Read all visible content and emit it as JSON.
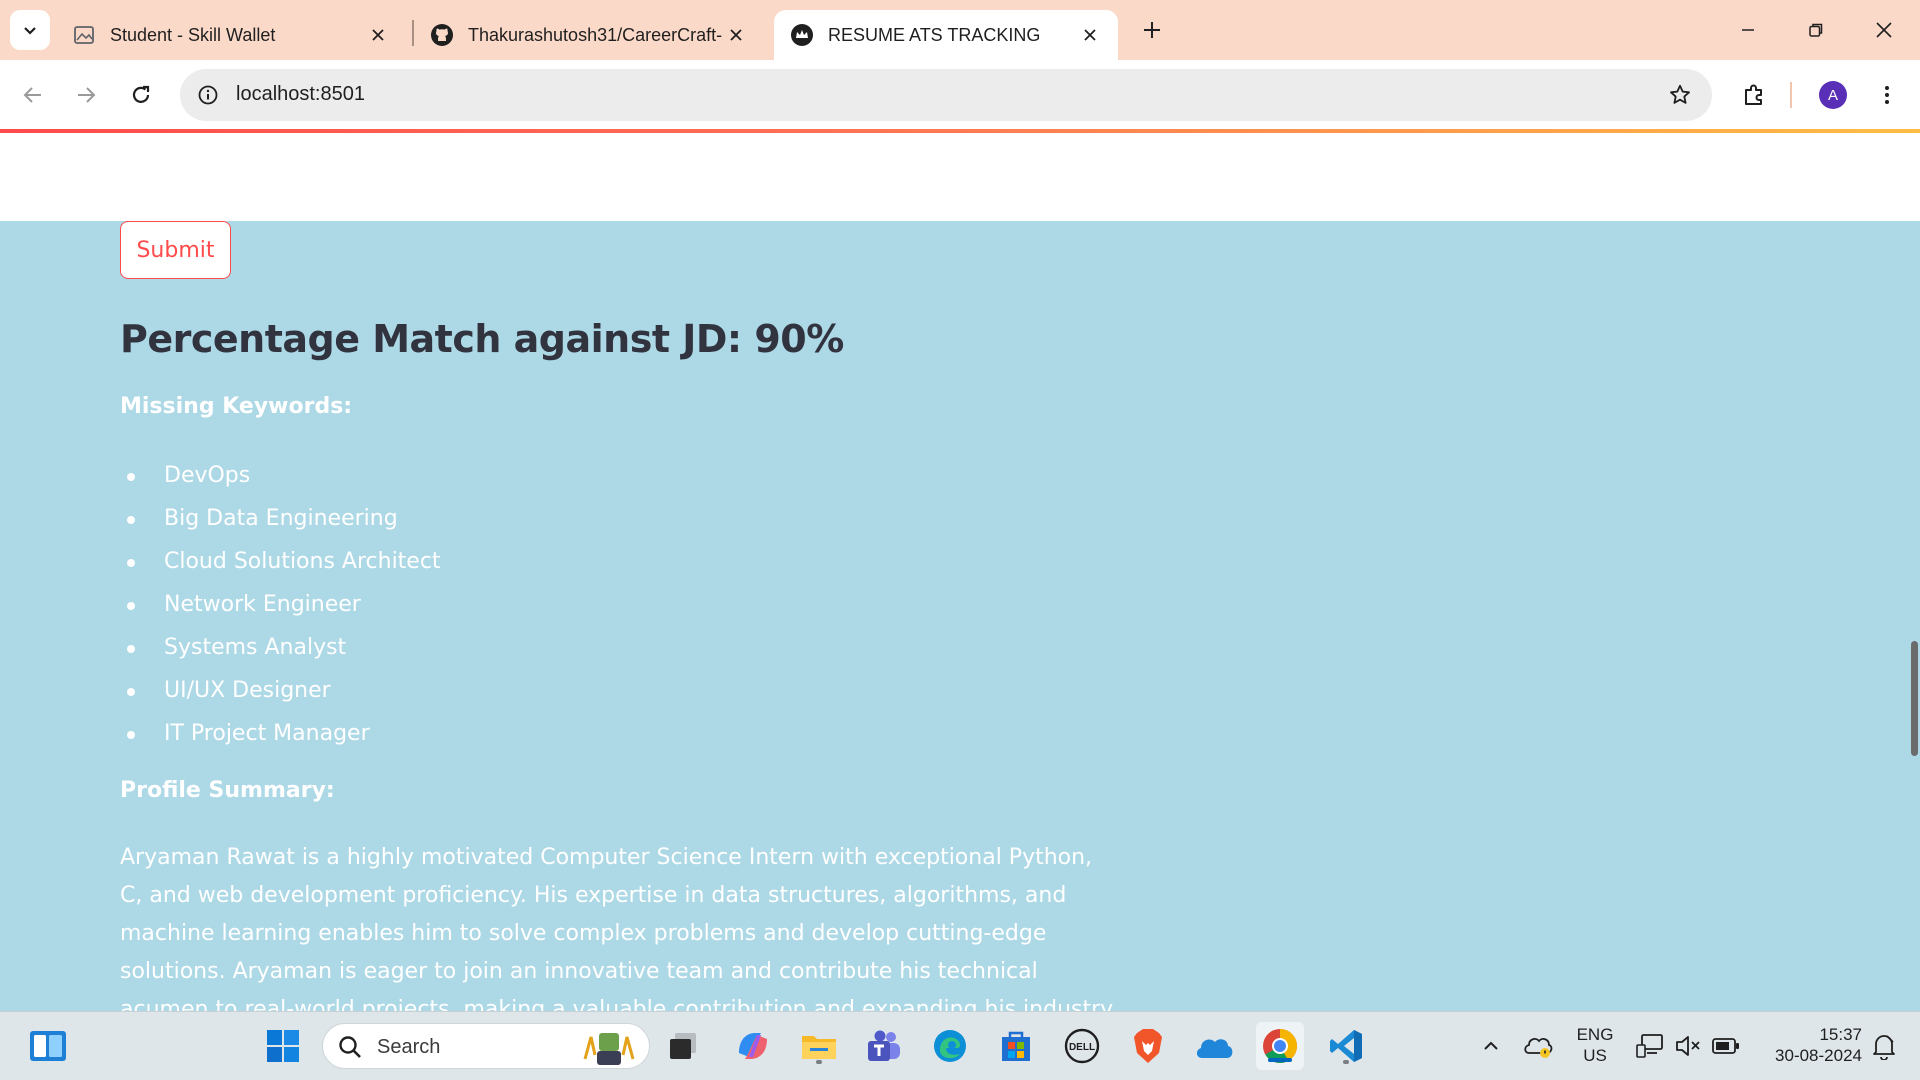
{
  "browser": {
    "tabs": [
      {
        "title": "Student - Skill Wallet",
        "icon": "image-broken-icon",
        "active": false
      },
      {
        "title": "Thakurashutosh31/CareerCraft-",
        "icon": "github-icon",
        "active": false
      },
      {
        "title": "RESUME ATS TRACKING",
        "icon": "streamlit-crown-icon",
        "active": true
      }
    ],
    "url": "localhost:8501",
    "profile_initial": "A"
  },
  "page": {
    "submit_label": "Submit",
    "heading": "Percentage Match against JD: 90%",
    "missing_keywords_label": "Missing Keywords:",
    "missing_keywords": [
      "DevOps",
      "Big Data Engineering",
      "Cloud Solutions Architect",
      "Network Engineer",
      "Systems Analyst",
      "UI/UX Designer",
      "IT Project Manager"
    ],
    "profile_summary_label": "Profile Summary:",
    "profile_summary": "Aryaman Rawat is a highly motivated Computer Science Intern with exceptional Python, C, and web development proficiency. His expertise in data structures, algorithms, and machine learning enables him to solve complex problems and develop cutting-edge solutions. Aryaman is eager to join an innovative team and contribute his technical acumen to real-world projects, making a valuable contribution and expanding his industry knowledge."
  },
  "taskbar": {
    "search_placeholder": "Search",
    "language_line1": "ENG",
    "language_line2": "US",
    "time": "15:37",
    "date": "30-08-2024"
  },
  "colors": {
    "tabstrip": "#fbd9c9",
    "page_background": "#add8e6",
    "accent_red": "#ff4b4b",
    "heading_text": "#31333f"
  }
}
